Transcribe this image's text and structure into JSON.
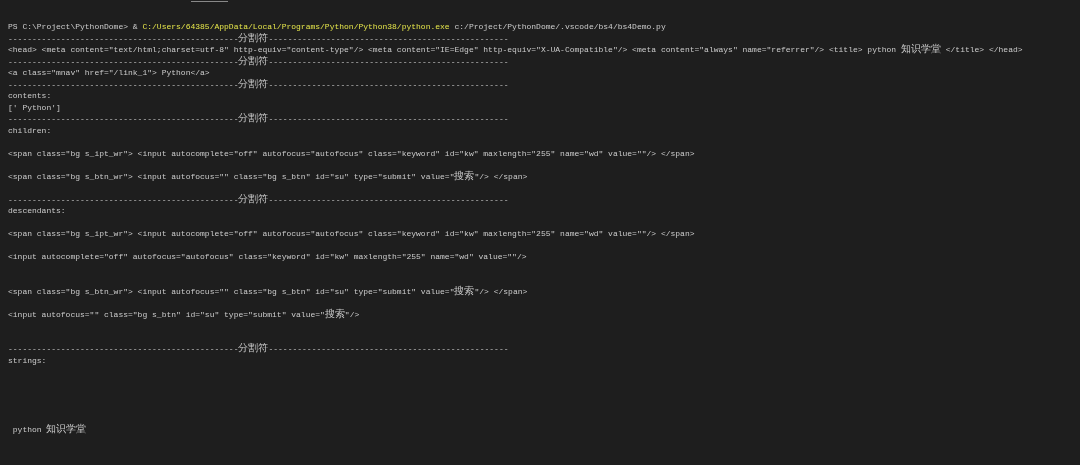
{
  "terminal": {
    "lines": [
      {
        "kind": "command",
        "prompt": "PS C:\\Project\\PythonDome> & ",
        "executable": "C:/Users/64385/AppData/Local/Programs/Python/Python38/python.exe",
        "args": " c:/Project/PythonDome/.vscode/bs4/bs4Demo.py"
      },
      {
        "kind": "separator",
        "text": "------------------------------------------------分割符--------------------------------------------------"
      },
      {
        "kind": "output",
        "text": "<head> <meta content=\"text/html;charset=utf-8\" http-equiv=\"content-type\"/> <meta content=\"IE=Edge\" http-equiv=\"X-UA-Compatible\"/> <meta content=\"always\" name=\"referrer\"/> <title> python 知识学堂 </title> </head>"
      },
      {
        "kind": "separator",
        "text": "------------------------------------------------分割符--------------------------------------------------"
      },
      {
        "kind": "output",
        "text": "<a class=\"mnav\" href=\"/link_1\"> Python</a>"
      },
      {
        "kind": "separator",
        "text": "------------------------------------------------分割符--------------------------------------------------"
      },
      {
        "kind": "output",
        "text": "contents:"
      },
      {
        "kind": "output",
        "text": "[' Python']"
      },
      {
        "kind": "separator",
        "text": "------------------------------------------------分割符--------------------------------------------------"
      },
      {
        "kind": "output",
        "text": "children:"
      },
      {
        "kind": "blank"
      },
      {
        "kind": "output",
        "text": "<span class=\"bg s_ipt_wr\"> <input autocomplete=\"off\" autofocus=\"autofocus\" class=\"keyword\" id=\"kw\" maxlength=\"255\" name=\"wd\" value=\"\"/> </span>"
      },
      {
        "kind": "blank"
      },
      {
        "kind": "output",
        "text": "<span class=\"bg s_btn_wr\"> <input autofocus=\"\" class=\"bg s_btn\" id=\"su\" type=\"submit\" value=\"搜索\"/> </span>"
      },
      {
        "kind": "blank"
      },
      {
        "kind": "separator",
        "text": "------------------------------------------------分割符--------------------------------------------------"
      },
      {
        "kind": "output",
        "text": "descendants:"
      },
      {
        "kind": "blank"
      },
      {
        "kind": "output",
        "text": "<span class=\"bg s_ipt_wr\"> <input autocomplete=\"off\" autofocus=\"autofocus\" class=\"keyword\" id=\"kw\" maxlength=\"255\" name=\"wd\" value=\"\"/> </span>"
      },
      {
        "kind": "blank"
      },
      {
        "kind": "output",
        "text": "<input autocomplete=\"off\" autofocus=\"autofocus\" class=\"keyword\" id=\"kw\" maxlength=\"255\" name=\"wd\" value=\"\"/>"
      },
      {
        "kind": "blank"
      },
      {
        "kind": "blank"
      },
      {
        "kind": "output",
        "text": "<span class=\"bg s_btn_wr\"> <input autofocus=\"\" class=\"bg s_btn\" id=\"su\" type=\"submit\" value=\"搜索\"/> </span>"
      },
      {
        "kind": "blank"
      },
      {
        "kind": "output",
        "text": "<input autofocus=\"\" class=\"bg s_btn\" id=\"su\" type=\"submit\" value=\"搜索\"/>"
      },
      {
        "kind": "blank"
      },
      {
        "kind": "blank"
      },
      {
        "kind": "separator",
        "text": "------------------------------------------------分割符--------------------------------------------------"
      },
      {
        "kind": "output",
        "text": "strings:"
      },
      {
        "kind": "blank"
      },
      {
        "kind": "blank"
      },
      {
        "kind": "blank"
      },
      {
        "kind": "blank"
      },
      {
        "kind": "blank"
      },
      {
        "kind": "output",
        "text": " python 知识学堂"
      }
    ]
  }
}
